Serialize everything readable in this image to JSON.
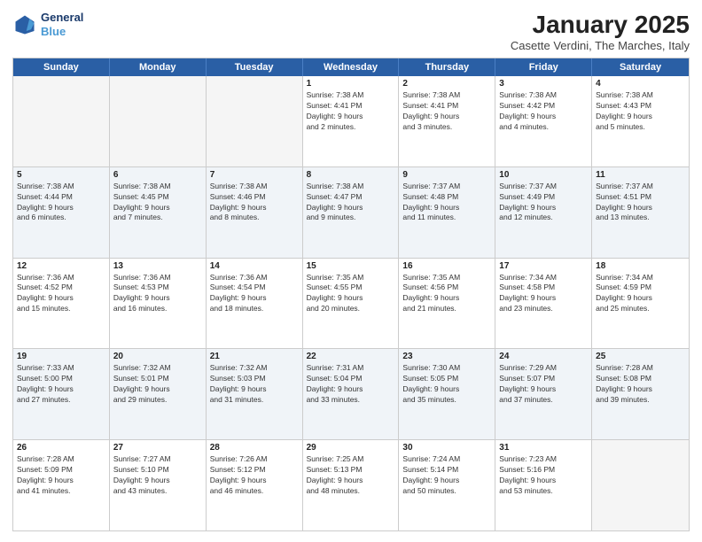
{
  "logo": {
    "line1": "General",
    "line2": "Blue"
  },
  "title": "January 2025",
  "subtitle": "Casette Verdini, The Marches, Italy",
  "header_days": [
    "Sunday",
    "Monday",
    "Tuesday",
    "Wednesday",
    "Thursday",
    "Friday",
    "Saturday"
  ],
  "rows": [
    [
      {
        "day": "",
        "info": "",
        "empty": true
      },
      {
        "day": "",
        "info": "",
        "empty": true
      },
      {
        "day": "",
        "info": "",
        "empty": true
      },
      {
        "day": "1",
        "info": "Sunrise: 7:38 AM\nSunset: 4:41 PM\nDaylight: 9 hours\nand 2 minutes."
      },
      {
        "day": "2",
        "info": "Sunrise: 7:38 AM\nSunset: 4:41 PM\nDaylight: 9 hours\nand 3 minutes."
      },
      {
        "day": "3",
        "info": "Sunrise: 7:38 AM\nSunset: 4:42 PM\nDaylight: 9 hours\nand 4 minutes."
      },
      {
        "day": "4",
        "info": "Sunrise: 7:38 AM\nSunset: 4:43 PM\nDaylight: 9 hours\nand 5 minutes."
      }
    ],
    [
      {
        "day": "5",
        "info": "Sunrise: 7:38 AM\nSunset: 4:44 PM\nDaylight: 9 hours\nand 6 minutes."
      },
      {
        "day": "6",
        "info": "Sunrise: 7:38 AM\nSunset: 4:45 PM\nDaylight: 9 hours\nand 7 minutes."
      },
      {
        "day": "7",
        "info": "Sunrise: 7:38 AM\nSunset: 4:46 PM\nDaylight: 9 hours\nand 8 minutes."
      },
      {
        "day": "8",
        "info": "Sunrise: 7:38 AM\nSunset: 4:47 PM\nDaylight: 9 hours\nand 9 minutes."
      },
      {
        "day": "9",
        "info": "Sunrise: 7:37 AM\nSunset: 4:48 PM\nDaylight: 9 hours\nand 11 minutes."
      },
      {
        "day": "10",
        "info": "Sunrise: 7:37 AM\nSunset: 4:49 PM\nDaylight: 9 hours\nand 12 minutes."
      },
      {
        "day": "11",
        "info": "Sunrise: 7:37 AM\nSunset: 4:51 PM\nDaylight: 9 hours\nand 13 minutes."
      }
    ],
    [
      {
        "day": "12",
        "info": "Sunrise: 7:36 AM\nSunset: 4:52 PM\nDaylight: 9 hours\nand 15 minutes."
      },
      {
        "day": "13",
        "info": "Sunrise: 7:36 AM\nSunset: 4:53 PM\nDaylight: 9 hours\nand 16 minutes."
      },
      {
        "day": "14",
        "info": "Sunrise: 7:36 AM\nSunset: 4:54 PM\nDaylight: 9 hours\nand 18 minutes."
      },
      {
        "day": "15",
        "info": "Sunrise: 7:35 AM\nSunset: 4:55 PM\nDaylight: 9 hours\nand 20 minutes."
      },
      {
        "day": "16",
        "info": "Sunrise: 7:35 AM\nSunset: 4:56 PM\nDaylight: 9 hours\nand 21 minutes."
      },
      {
        "day": "17",
        "info": "Sunrise: 7:34 AM\nSunset: 4:58 PM\nDaylight: 9 hours\nand 23 minutes."
      },
      {
        "day": "18",
        "info": "Sunrise: 7:34 AM\nSunset: 4:59 PM\nDaylight: 9 hours\nand 25 minutes."
      }
    ],
    [
      {
        "day": "19",
        "info": "Sunrise: 7:33 AM\nSunset: 5:00 PM\nDaylight: 9 hours\nand 27 minutes."
      },
      {
        "day": "20",
        "info": "Sunrise: 7:32 AM\nSunset: 5:01 PM\nDaylight: 9 hours\nand 29 minutes."
      },
      {
        "day": "21",
        "info": "Sunrise: 7:32 AM\nSunset: 5:03 PM\nDaylight: 9 hours\nand 31 minutes."
      },
      {
        "day": "22",
        "info": "Sunrise: 7:31 AM\nSunset: 5:04 PM\nDaylight: 9 hours\nand 33 minutes."
      },
      {
        "day": "23",
        "info": "Sunrise: 7:30 AM\nSunset: 5:05 PM\nDaylight: 9 hours\nand 35 minutes."
      },
      {
        "day": "24",
        "info": "Sunrise: 7:29 AM\nSunset: 5:07 PM\nDaylight: 9 hours\nand 37 minutes."
      },
      {
        "day": "25",
        "info": "Sunrise: 7:28 AM\nSunset: 5:08 PM\nDaylight: 9 hours\nand 39 minutes."
      }
    ],
    [
      {
        "day": "26",
        "info": "Sunrise: 7:28 AM\nSunset: 5:09 PM\nDaylight: 9 hours\nand 41 minutes."
      },
      {
        "day": "27",
        "info": "Sunrise: 7:27 AM\nSunset: 5:10 PM\nDaylight: 9 hours\nand 43 minutes."
      },
      {
        "day": "28",
        "info": "Sunrise: 7:26 AM\nSunset: 5:12 PM\nDaylight: 9 hours\nand 46 minutes."
      },
      {
        "day": "29",
        "info": "Sunrise: 7:25 AM\nSunset: 5:13 PM\nDaylight: 9 hours\nand 48 minutes."
      },
      {
        "day": "30",
        "info": "Sunrise: 7:24 AM\nSunset: 5:14 PM\nDaylight: 9 hours\nand 50 minutes."
      },
      {
        "day": "31",
        "info": "Sunrise: 7:23 AM\nSunset: 5:16 PM\nDaylight: 9 hours\nand 53 minutes."
      },
      {
        "day": "",
        "info": "",
        "empty": true
      }
    ]
  ]
}
